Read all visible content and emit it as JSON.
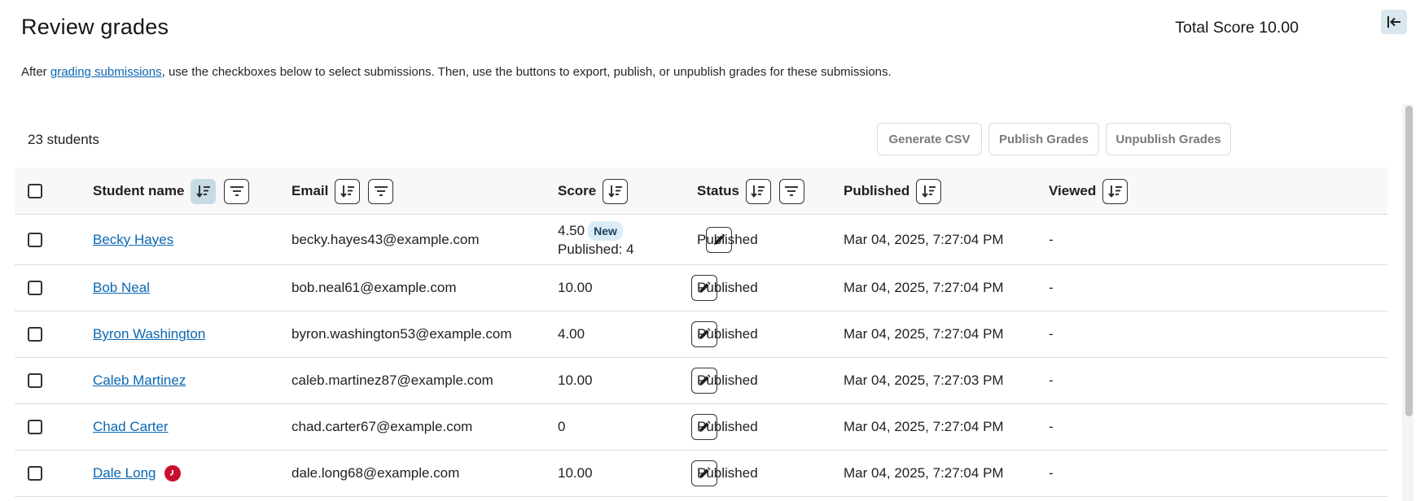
{
  "header": {
    "title": "Review grades",
    "total_score": "Total Score 10.00",
    "collapse_icon": "collapse-left-icon"
  },
  "instructions": {
    "prefix": "After ",
    "link": "grading submissions",
    "suffix": ", use the checkboxes below to select submissions. Then, use the buttons to export, publish, or unpublish grades for these submissions."
  },
  "toolbar": {
    "count": "23 students",
    "generate_csv": "Generate CSV",
    "publish": "Publish Grades",
    "unpublish": "Unpublish Grades"
  },
  "columns": {
    "student_name": "Student name",
    "email": "Email",
    "score": "Score",
    "status": "Status",
    "published": "Published",
    "viewed": "Viewed"
  },
  "rows": [
    {
      "name": "Becky Hayes",
      "email": "becky.hayes43@example.com",
      "score": "4.50",
      "badge": "New",
      "published_score": "Published: 4",
      "status": "Published",
      "published": "Mar 04, 2025, 7:27:04 PM",
      "viewed": "-",
      "late": false
    },
    {
      "name": "Bob Neal",
      "email": "bob.neal61@example.com",
      "score": "10.00",
      "status": "Published",
      "published": "Mar 04, 2025, 7:27:04 PM",
      "viewed": "-",
      "late": false
    },
    {
      "name": "Byron Washington",
      "email": "byron.washington53@example.com",
      "score": "4.00",
      "status": "Published",
      "published": "Mar 04, 2025, 7:27:04 PM",
      "viewed": "-",
      "late": false
    },
    {
      "name": "Caleb Martinez",
      "email": "caleb.martinez87@example.com",
      "score": "10.00",
      "status": "Published",
      "published": "Mar 04, 2025, 7:27:03 PM",
      "viewed": "-",
      "late": false
    },
    {
      "name": "Chad Carter",
      "email": "chad.carter67@example.com",
      "score": "0",
      "status": "Published",
      "published": "Mar 04, 2025, 7:27:04 PM",
      "viewed": "-",
      "late": false
    },
    {
      "name": "Dale Long",
      "email": "dale.long68@example.com",
      "score": "10.00",
      "status": "Published",
      "published": "Mar 04, 2025, 7:27:04 PM",
      "viewed": "-",
      "late": true
    }
  ],
  "colors": {
    "link": "#0b67b2",
    "late_badge": "#c8102e",
    "new_badge_bg": "#d9ecf8",
    "active_sort_bg": "#c7dbe5"
  }
}
